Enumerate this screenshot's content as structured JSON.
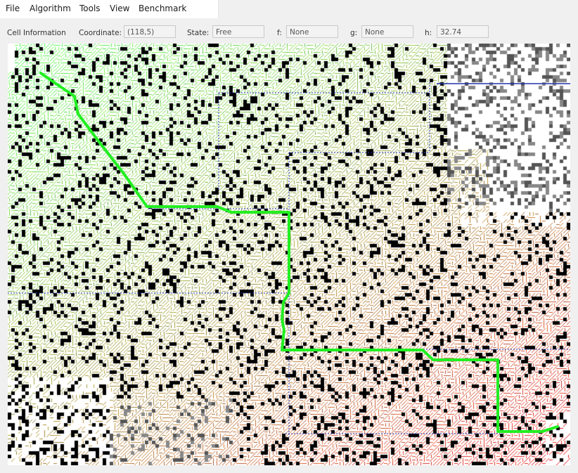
{
  "menu": {
    "items": [
      "File",
      "Algorithm",
      "Tools",
      "View",
      "Benchmark"
    ]
  },
  "cell_info": {
    "title": "Cell Information",
    "coordinate_label": "Coordinate:",
    "coordinate_value": "(118,5)",
    "state_label": "State:",
    "state_value": "Free",
    "f_label": "f:",
    "f_value": "None",
    "g_label": "g:",
    "g_value": "None",
    "h_label": "h:",
    "h_value": "32.74"
  },
  "colors": {
    "path": "#22ee22",
    "region_lines": "#2233aa",
    "explored_near": "#55ff55",
    "explored_far": "#ff2222",
    "obstacle": "#000000",
    "free": "#ffffff"
  }
}
